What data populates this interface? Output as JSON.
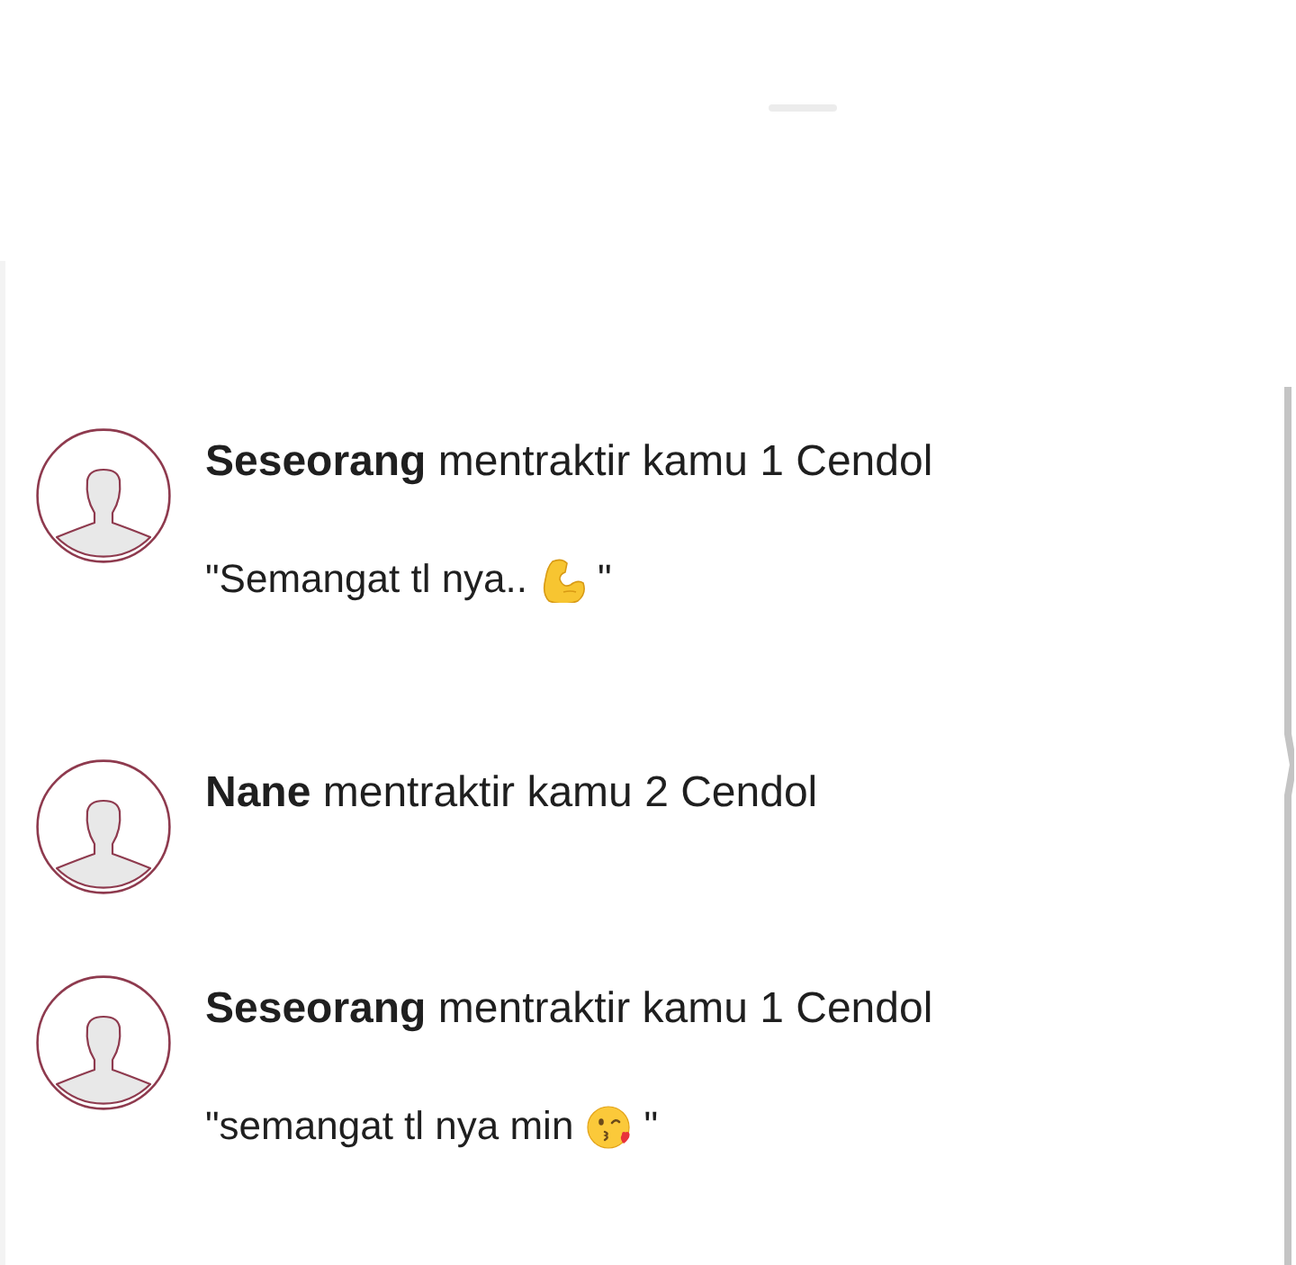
{
  "notifications": [
    {
      "title": "**Seseorang** mentraktir kamu 1 Cendol",
      "message": [
        {
          "kind": "text",
          "text": "\"Semangat tl nya.."
        },
        {
          "kind": "muscle"
        },
        {
          "kind": "text",
          "text": "\""
        }
      ]
    },
    {
      "title": "**Nane** mentraktir kamu 2 Cendol"
    },
    {
      "title": "**Seseorang** mentraktir kamu 1 Cendol",
      "message": [
        {
          "kind": "text",
          "text": "\"semangat tl nya min"
        },
        {
          "kind": "kiss"
        },
        {
          "kind": "text",
          "text": "\""
        }
      ]
    }
  ]
}
